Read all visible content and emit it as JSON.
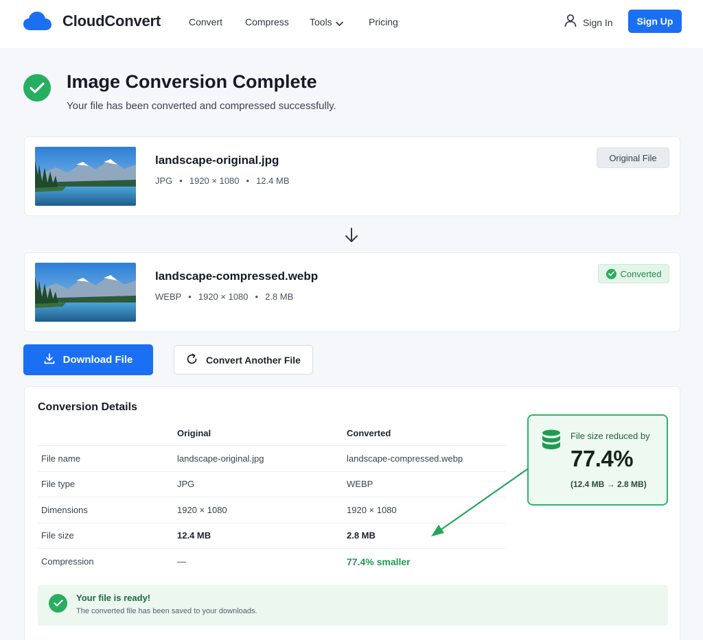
{
  "header": {
    "brand": "CloudConvert",
    "nav": [
      "Convert",
      "Compress",
      "Tools",
      "Pricing"
    ],
    "sign_in": "Sign In",
    "sign_up": "Sign Up"
  },
  "page": {
    "title": "Image Conversion Complete",
    "subtitle": "Your file has been converted and compressed successfully."
  },
  "original_file": {
    "name": "landscape-original.jpg",
    "type": "JPG",
    "dimensions": "1920 × 1080",
    "size": "12.4 MB",
    "badge": "Original File"
  },
  "converted_file": {
    "name": "landscape-compressed.webp",
    "type": "WEBP",
    "dimensions": "1920 × 1080",
    "size": "2.8 MB",
    "badge": "Converted"
  },
  "actions": {
    "download": "Download File",
    "convert_another": "Convert Another File"
  },
  "details": {
    "title": "Conversion Details",
    "columns": [
      "",
      "Original",
      "Converted"
    ],
    "rows": [
      {
        "label": "File name",
        "original": "landscape-original.jpg",
        "converted": "landscape-compressed.webp"
      },
      {
        "label": "File type",
        "original": "JPG",
        "converted": "WEBP"
      },
      {
        "label": "Dimensions",
        "original": "1920 × 1080",
        "converted": "1920 × 1080"
      },
      {
        "label": "File size",
        "original": "12.4 MB",
        "converted": "2.8 MB"
      },
      {
        "label": "Compression",
        "original": "—",
        "converted": "77.4% smaller"
      }
    ]
  },
  "reduction": {
    "label": "File size reduced by",
    "percent": "77.4%",
    "detail": "(12.4 MB → 2.8 MB)"
  },
  "ready": {
    "title": "Your file is ready!",
    "subtitle": "The converted file has been saved to your downloads."
  },
  "colors": {
    "primary": "#1a6ff3",
    "success": "#27ae60",
    "success_text": "#1e9b50"
  }
}
